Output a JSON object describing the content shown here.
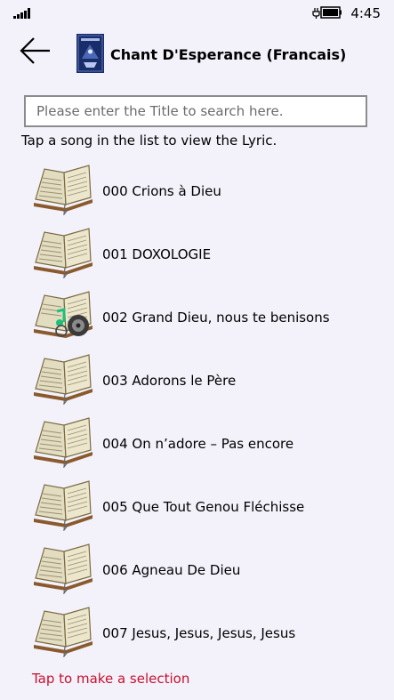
{
  "status_bar": {
    "time": "4:45",
    "icons": [
      "signal-icon",
      "battery-charging-icon"
    ]
  },
  "header": {
    "title": "Chant D'Esperance (Francais)",
    "back_icon": "arrow-left-icon"
  },
  "search": {
    "placeholder": "Please enter the Title to search here.",
    "value": ""
  },
  "instruction": "Tap a song in the list to view the Lyric.",
  "songs": [
    {
      "title": "000 Crions à Dieu",
      "icon": "book-icon"
    },
    {
      "title": "001 DOXOLOGIE",
      "icon": "book-icon"
    },
    {
      "title": "002 Grand Dieu, nous te benisons",
      "icon": "book-audio-icon"
    },
    {
      "title": "003 Adorons le Père",
      "icon": "book-icon"
    },
    {
      "title": "004 On n’adore – Pas encore",
      "icon": "book-icon"
    },
    {
      "title": "005 Que Tout Genou Fléchisse",
      "icon": "book-icon"
    },
    {
      "title": "006 Agneau De Dieu",
      "icon": "book-icon"
    },
    {
      "title": "007 Jesus, Jesus, Jesus, Jesus",
      "icon": "book-icon"
    }
  ],
  "footer_hint": "Tap to make a selection",
  "colors": {
    "background": "#f3f2fb",
    "hint": "#c8102e",
    "input_border": "#8c8c8c"
  }
}
